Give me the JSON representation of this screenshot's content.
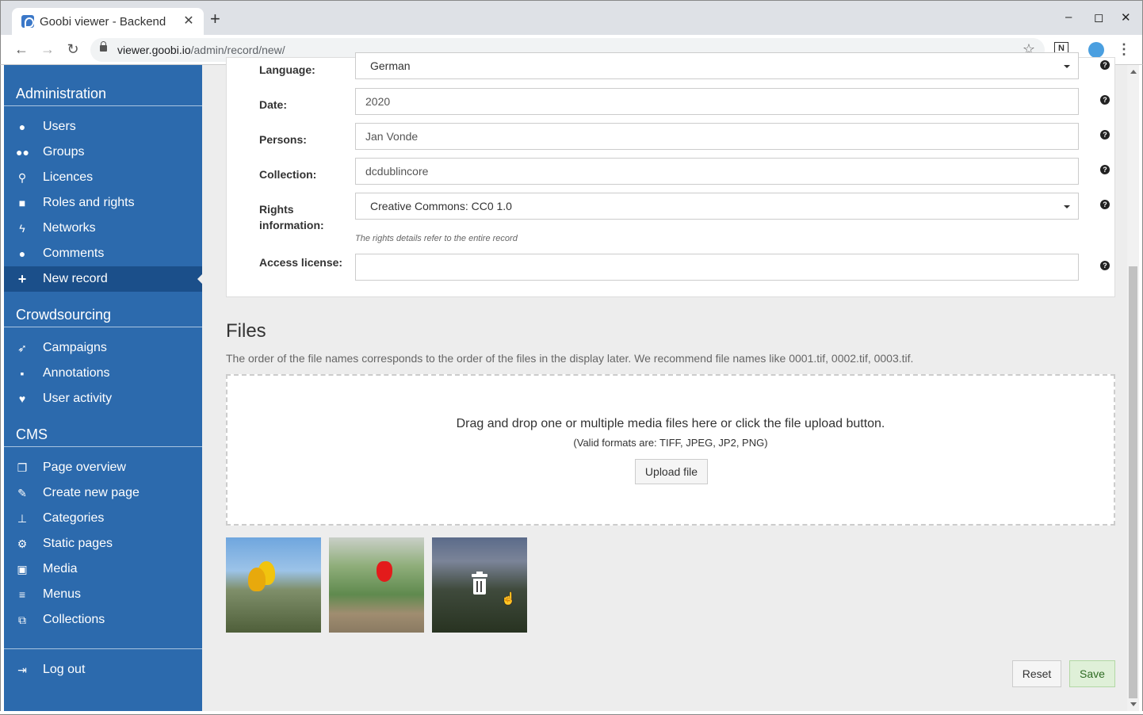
{
  "browser": {
    "tab_title": "Goobi viewer - Backend",
    "url_host": "viewer.goobi.io",
    "url_path": "/admin/record/new/"
  },
  "sidebar": {
    "sections": [
      {
        "heading": "Administration",
        "items": [
          {
            "label": "Users",
            "icon": "user-icon"
          },
          {
            "label": "Groups",
            "icon": "group-icon"
          },
          {
            "label": "Licences",
            "icon": "key-icon"
          },
          {
            "label": "Roles and rights",
            "icon": "lock-icon"
          },
          {
            "label": "Networks",
            "icon": "bolt-icon"
          },
          {
            "label": "Comments",
            "icon": "comments-icon"
          },
          {
            "label": "New record",
            "icon": "plus-icon",
            "active": true
          }
        ]
      },
      {
        "heading": "Crowdsourcing",
        "items": [
          {
            "label": "Campaigns",
            "icon": "rocket-icon"
          },
          {
            "label": "Annotations",
            "icon": "note-icon"
          },
          {
            "label": "User activity",
            "icon": "heartbeat-icon"
          }
        ]
      },
      {
        "heading": "CMS",
        "items": [
          {
            "label": "Page overview",
            "icon": "copy-icon"
          },
          {
            "label": "Create new page",
            "icon": "edit-icon"
          },
          {
            "label": "Categories",
            "icon": "pin-icon"
          },
          {
            "label": "Static pages",
            "icon": "cogs-icon"
          },
          {
            "label": "Media",
            "icon": "image-icon"
          },
          {
            "label": "Menus",
            "icon": "bars-icon"
          },
          {
            "label": "Collections",
            "icon": "object-group-icon"
          }
        ]
      }
    ],
    "logout": {
      "label": "Log out",
      "icon": "sign-out-icon"
    }
  },
  "form": {
    "language": {
      "label": "Language:",
      "value": "German"
    },
    "date": {
      "label": "Date:",
      "value": "2020"
    },
    "persons": {
      "label": "Persons:",
      "value": "Jan Vonde"
    },
    "collection": {
      "label": "Collection:",
      "value": "dcdublincore"
    },
    "rights": {
      "label_line1": "Rights",
      "label_line2": "information:",
      "value": "Creative Commons: CC0 1.0",
      "hint": "The rights details refer to the entire record"
    },
    "access": {
      "label": "Access license:",
      "value": ""
    },
    "help_glyph": "?"
  },
  "files": {
    "title": "Files",
    "description": "The order of the file names corresponds to the order of the files in the display later. We recommend file names like 0001.tif, 0002.tif, 0003.tif.",
    "dropzone_text": "Drag and drop one or multiple media files here or click the file upload button.",
    "dropzone_formats": "(Valid formats are: TIFF, JPEG, JP2, PNG)",
    "upload_label": "Upload file"
  },
  "actions": {
    "reset": "Reset",
    "save": "Save"
  }
}
